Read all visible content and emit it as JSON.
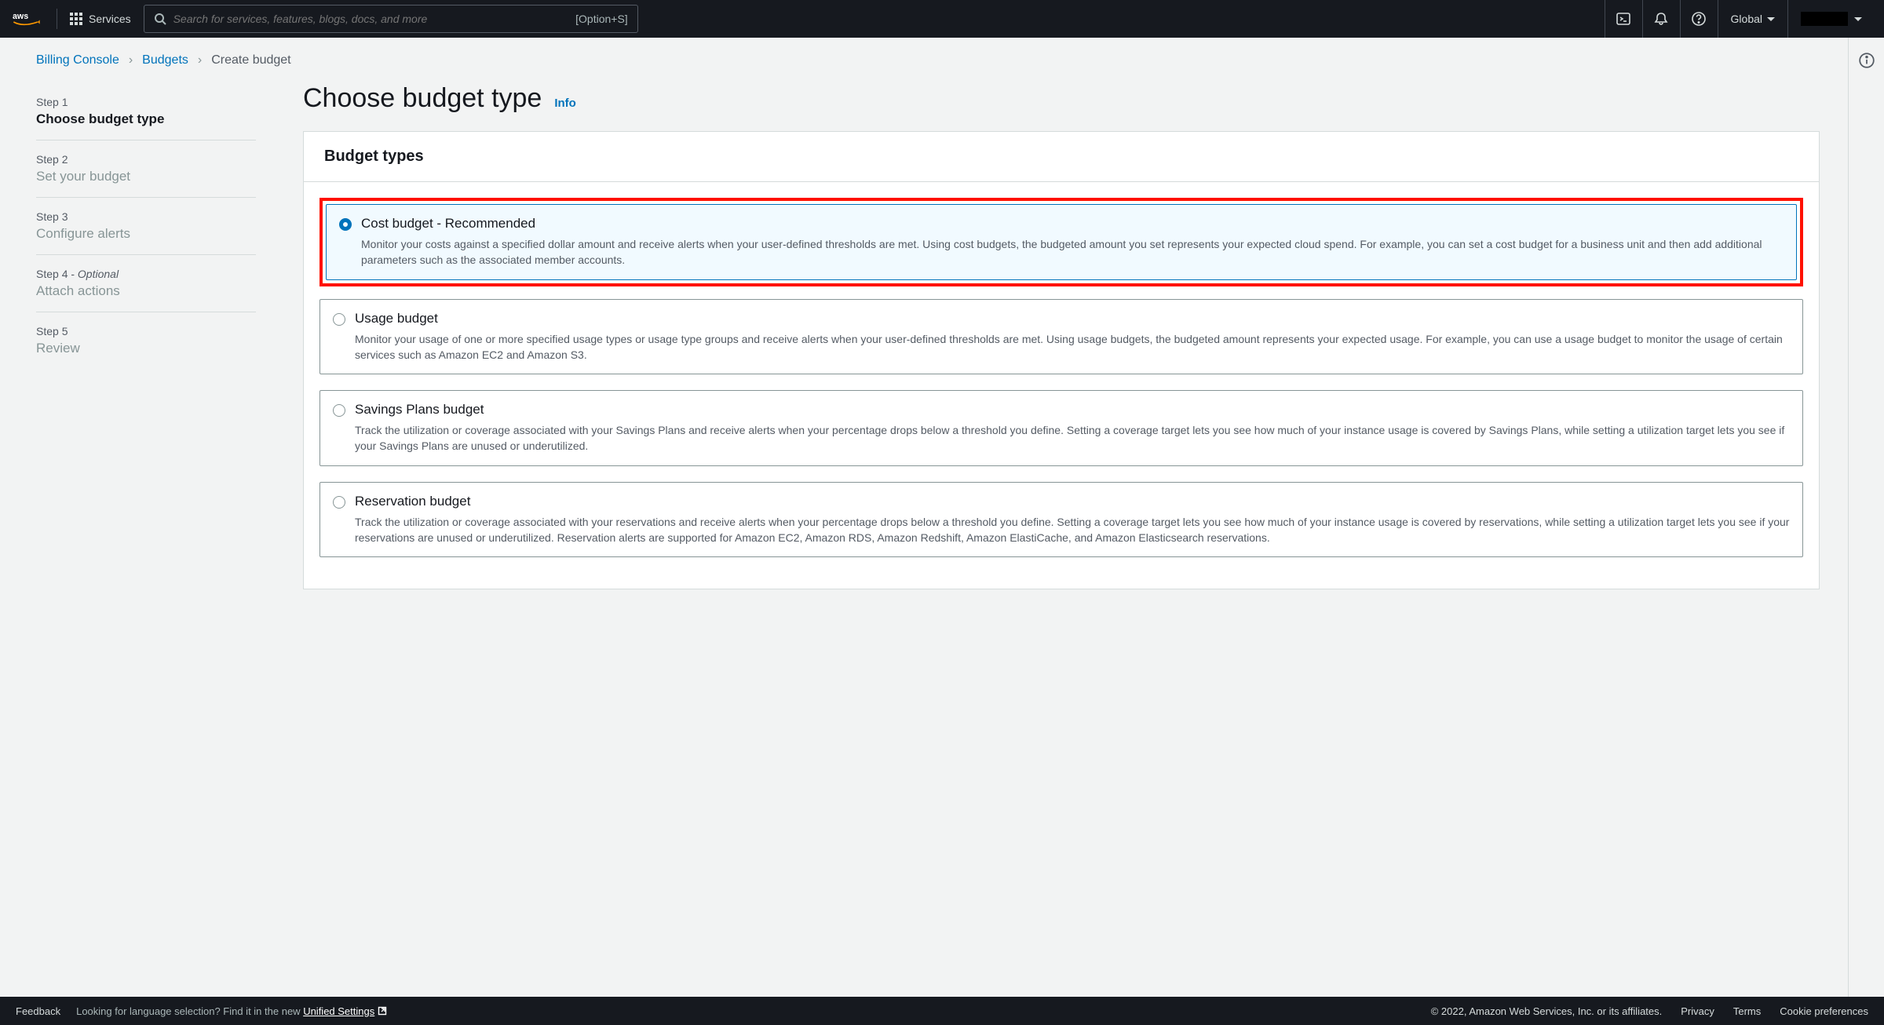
{
  "topbar": {
    "services_label": "Services",
    "search_placeholder": "Search for services, features, blogs, docs, and more",
    "search_shortcut": "[Option+S]",
    "region": "Global"
  },
  "breadcrumbs": {
    "billing": "Billing Console",
    "budgets": "Budgets",
    "create": "Create budget"
  },
  "wizard": {
    "step1_label": "Step 1",
    "step1_title": "Choose budget type",
    "step2_label": "Step 2",
    "step2_title": "Set your budget",
    "step3_label": "Step 3",
    "step3_title": "Configure alerts",
    "step4_label": "Step 4 - ",
    "step4_optional": "Optional",
    "step4_title": "Attach actions",
    "step5_label": "Step 5",
    "step5_title": "Review"
  },
  "page": {
    "title": "Choose budget type",
    "info_link": "Info"
  },
  "panel": {
    "header": "Budget types"
  },
  "options": {
    "cost": {
      "title": "Cost budget - Recommended",
      "desc": "Monitor your costs against a specified dollar amount and receive alerts when your user-defined thresholds are met. Using cost budgets, the budgeted amount you set represents your expected cloud spend. For example, you can set a cost budget for a business unit and then add additional parameters such as the associated member accounts."
    },
    "usage": {
      "title": "Usage budget",
      "desc": "Monitor your usage of one or more specified usage types or usage type groups and receive alerts when your user-defined thresholds are met. Using usage budgets, the budgeted amount represents your expected usage. For example, you can use a usage budget to monitor the usage of certain services such as Amazon EC2 and Amazon S3."
    },
    "savings": {
      "title": "Savings Plans budget",
      "desc": "Track the utilization or coverage associated with your Savings Plans and receive alerts when your percentage drops below a threshold you define. Setting a coverage target lets you see how much of your instance usage is covered by Savings Plans, while setting a utilization target lets you see if your Savings Plans are unused or underutilized."
    },
    "reservation": {
      "title": "Reservation budget",
      "desc": "Track the utilization or coverage associated with your reservations and receive alerts when your percentage drops below a threshold you define. Setting a coverage target lets you see how much of your instance usage is covered by reservations, while setting a utilization target lets you see if your reservations are unused or underutilized. Reservation alerts are supported for Amazon EC2, Amazon RDS, Amazon Redshift, Amazon ElastiCache, and Amazon Elasticsearch reservations."
    }
  },
  "footer": {
    "feedback": "Feedback",
    "lang_msg": "Looking for language selection? Find it in the new ",
    "lang_link": "Unified Settings",
    "copyright": "© 2022, Amazon Web Services, Inc. or its affiliates.",
    "privacy": "Privacy",
    "terms": "Terms",
    "cookie": "Cookie preferences"
  }
}
